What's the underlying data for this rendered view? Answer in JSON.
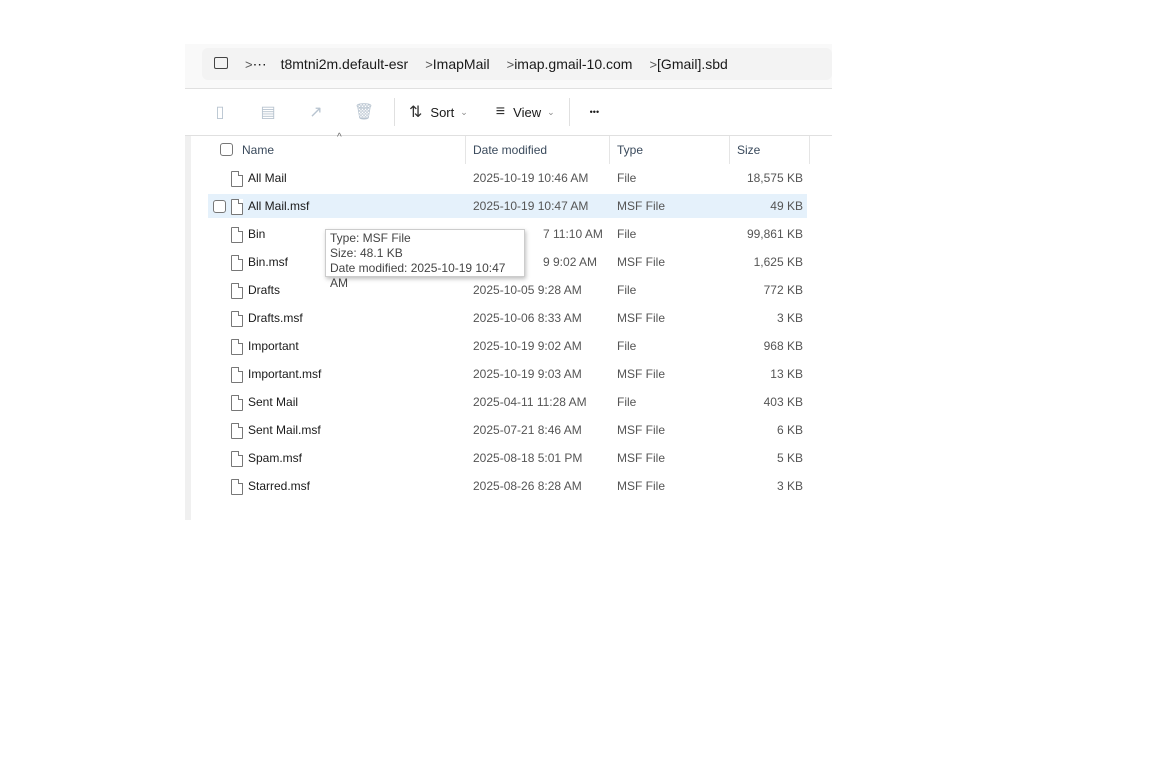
{
  "breadcrumb": {
    "root_icon": "computer-icon",
    "overflow": "⋯",
    "items": [
      "t8mtni2m.default-esr",
      "ImapMail",
      "imap.gmail-10.com",
      "[Gmail].sbd"
    ]
  },
  "toolbar": {
    "paste_icon": "clipboard-icon",
    "rename_icon": "rename-icon",
    "share_icon": "share-icon",
    "delete_icon": "trash-icon",
    "sort_label": "Sort",
    "view_label": "View",
    "more_label": "•••"
  },
  "columns": {
    "name": "Name",
    "date": "Date modified",
    "type": "Type",
    "size": "Size"
  },
  "files": [
    {
      "name": "All Mail",
      "date": "2025-10-19 10:46 AM",
      "type": "File",
      "size": "18,575 KB"
    },
    {
      "name": "All Mail.msf",
      "date": "2025-10-19 10:47 AM",
      "type": "MSF File",
      "size": "49 KB",
      "selected": true
    },
    {
      "name": "Bin",
      "date": "7 11:10 AM",
      "type": "File",
      "size": "99,861 KB",
      "date_partially_hidden": true
    },
    {
      "name": "Bin.msf",
      "date": "9 9:02 AM",
      "type": "MSF File",
      "size": "1,625 KB",
      "date_partially_hidden": true
    },
    {
      "name": "Drafts",
      "date": "2025-10-05 9:28 AM",
      "type": "File",
      "size": "772 KB"
    },
    {
      "name": "Drafts.msf",
      "date": "2025-10-06 8:33 AM",
      "type": "MSF File",
      "size": "3 KB"
    },
    {
      "name": "Important",
      "date": "2025-10-19 9:02 AM",
      "type": "File",
      "size": "968 KB"
    },
    {
      "name": "Important.msf",
      "date": "2025-10-19 9:03 AM",
      "type": "MSF File",
      "size": "13 KB"
    },
    {
      "name": "Sent Mail",
      "date": "2025-04-11 11:28 AM",
      "type": "File",
      "size": "403 KB"
    },
    {
      "name": "Sent Mail.msf",
      "date": "2025-07-21 8:46 AM",
      "type": "MSF File",
      "size": "6 KB"
    },
    {
      "name": "Spam.msf",
      "date": "2025-08-18 5:01 PM",
      "type": "MSF File",
      "size": "5 KB"
    },
    {
      "name": "Starred.msf",
      "date": "2025-08-26 8:28 AM",
      "type": "MSF File",
      "size": "3 KB"
    }
  ],
  "tooltip": {
    "type": "Type: MSF File",
    "size": "Size: 48.1 KB",
    "date": "Date modified: 2025-10-19 10:47 AM"
  },
  "colors": {
    "selection": "#e5f1fb",
    "toolbar_disabled": "#b8c4d0"
  }
}
